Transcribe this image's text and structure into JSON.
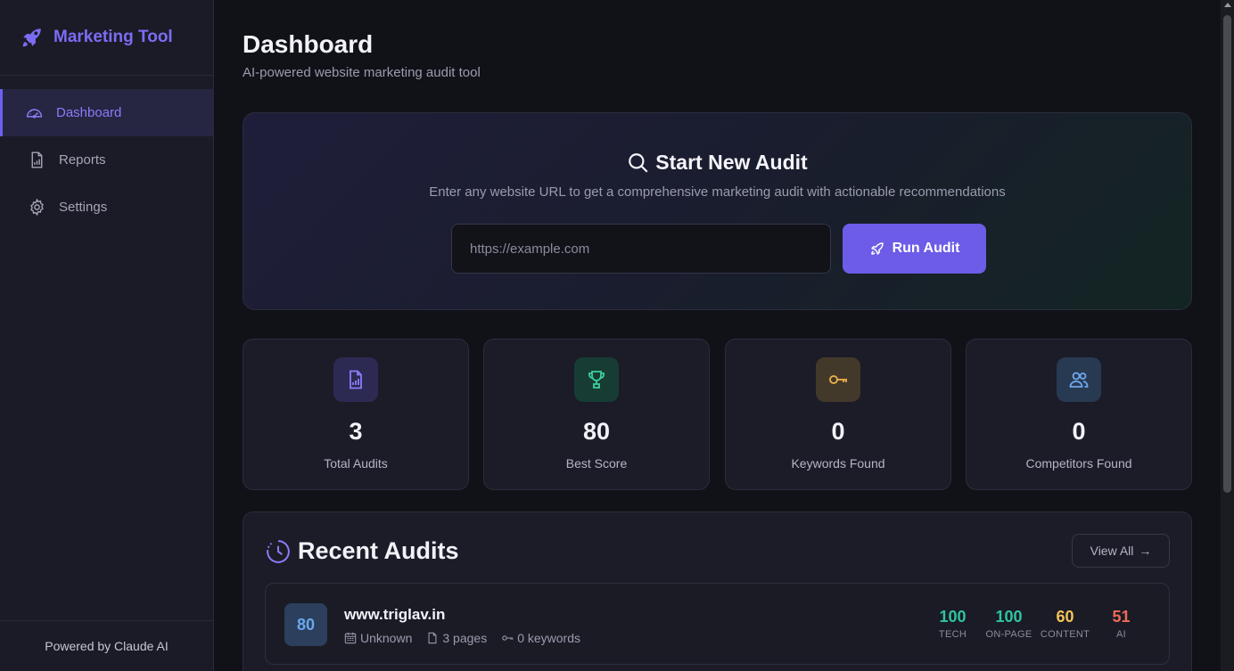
{
  "brand": {
    "name": "Marketing Tool",
    "icon": "rocket-icon"
  },
  "sidebar": {
    "items": [
      {
        "label": "Dashboard",
        "icon": "gauge-icon",
        "active": true
      },
      {
        "label": "Reports",
        "icon": "report-file-icon",
        "active": false
      },
      {
        "label": "Settings",
        "icon": "gear-icon",
        "active": false
      }
    ],
    "footer": "Powered by Claude AI"
  },
  "header": {
    "title": "Dashboard",
    "subtitle": "AI-powered website marketing audit tool"
  },
  "audit": {
    "title": "Start New Audit",
    "description": "Enter any website URL to get a comprehensive marketing audit with actionable recommendations",
    "input_placeholder": "https://example.com",
    "input_value": "",
    "button_label": "Run Audit"
  },
  "stats": [
    {
      "value": "3",
      "label": "Total Audits",
      "icon": "file-chart-icon",
      "color": "#8b7cf8",
      "bg": "#2c2a52"
    },
    {
      "value": "80",
      "label": "Best Score",
      "icon": "trophy-icon",
      "color": "#3ccf9a",
      "bg": "#173c34"
    },
    {
      "value": "0",
      "label": "Keywords Found",
      "icon": "key-icon",
      "color": "#f0b44a",
      "bg": "#42392a"
    },
    {
      "value": "0",
      "label": "Competitors Found",
      "icon": "users-icon",
      "color": "#6ea8ee",
      "bg": "#283a52"
    }
  ],
  "recent": {
    "title": "Recent Audits",
    "view_all_label": "View All",
    "rows": [
      {
        "score": "80",
        "domain": "www.triglav.in",
        "meta": {
          "date": "Unknown",
          "pages": "3 pages",
          "keywords": "0 keywords"
        },
        "metrics": [
          {
            "value": "100",
            "label": "TECH",
            "color": "#2ec4a0"
          },
          {
            "value": "100",
            "label": "ON-PAGE",
            "color": "#2ec4a0"
          },
          {
            "value": "60",
            "label": "CONTENT",
            "color": "#f4c25a"
          },
          {
            "value": "51",
            "label": "AI",
            "color": "#f06a5a"
          }
        ]
      }
    ]
  },
  "colors": {
    "accent": "#6c5ce7",
    "background": "#111118",
    "sidebar": "#1a1b26"
  }
}
